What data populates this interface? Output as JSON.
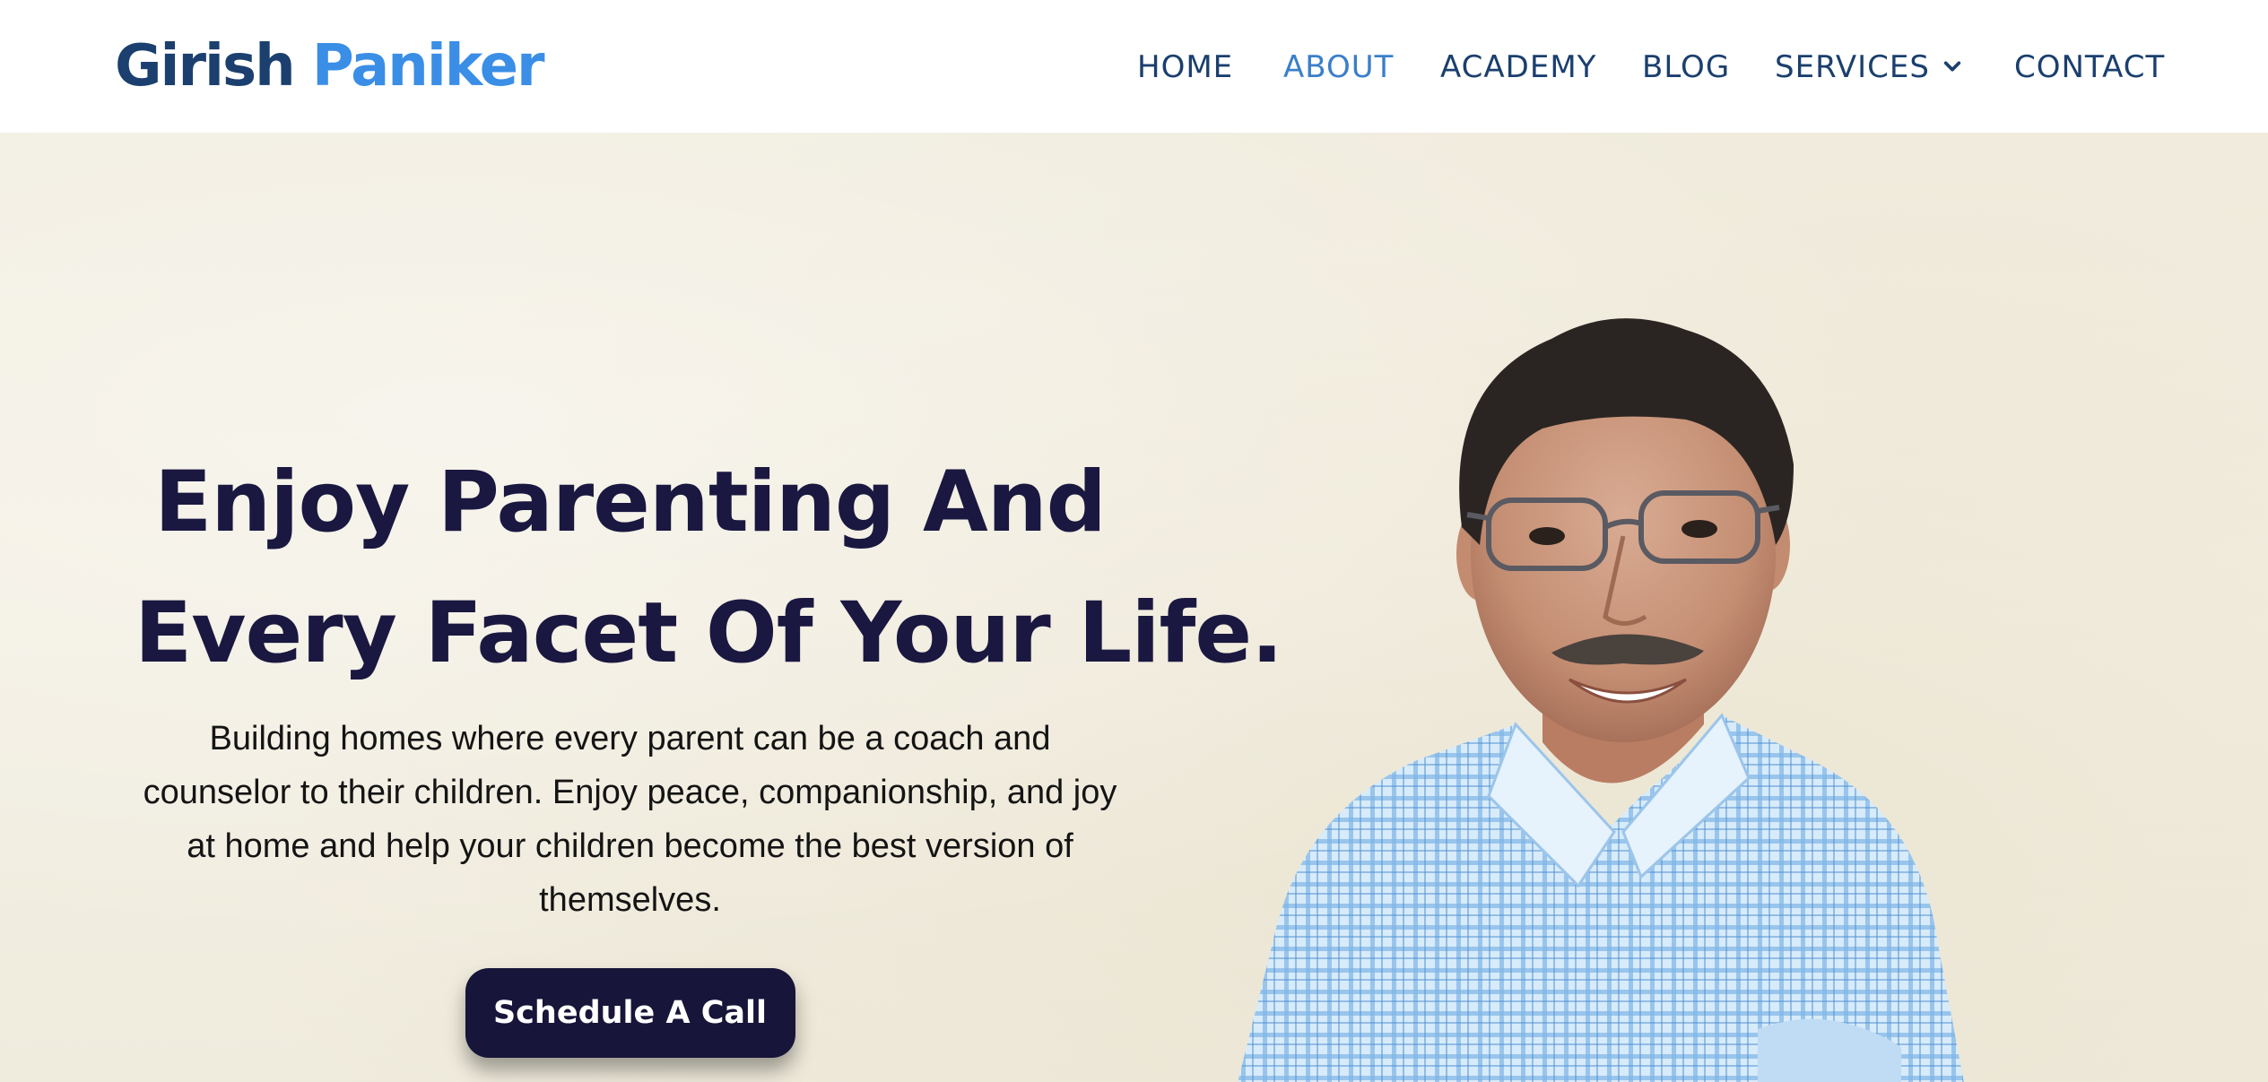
{
  "brand": {
    "first_name": "Girish",
    "last_name": "Paniker"
  },
  "nav": {
    "items": [
      {
        "label": "HOME"
      },
      {
        "label": "ABOUT"
      },
      {
        "label": "ACADEMY"
      },
      {
        "label": "BLOG"
      },
      {
        "label": "SERVICES"
      },
      {
        "label": "CONTACT"
      }
    ],
    "active": "ABOUT"
  },
  "hero": {
    "headline_line1": "Enjoy Parenting And",
    "headline_line2": "Every Facet Of Your Life.",
    "description": "Building homes where every parent can be a coach and counselor to their children. Enjoy peace, companionship, and joy at home and help your children become the best version of themselves.",
    "cta_label": "Schedule A Call"
  },
  "colors": {
    "brand_dark": "#1b3f6e",
    "brand_light": "#3a8ee6",
    "nav_active": "#3a7fc9",
    "headline": "#1a1840",
    "button_bg": "#171539",
    "hero_bg": "#f1ede0"
  },
  "icons": {
    "services_dropdown": "chevron-down-icon"
  }
}
